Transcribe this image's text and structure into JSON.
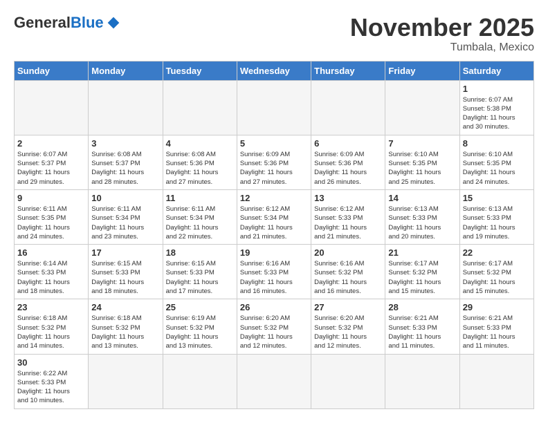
{
  "header": {
    "logo_general": "General",
    "logo_blue": "Blue",
    "month_title": "November 2025",
    "location": "Tumbala, Mexico"
  },
  "days_of_week": [
    "Sunday",
    "Monday",
    "Tuesday",
    "Wednesday",
    "Thursday",
    "Friday",
    "Saturday"
  ],
  "weeks": [
    [
      {
        "day": "",
        "info": ""
      },
      {
        "day": "",
        "info": ""
      },
      {
        "day": "",
        "info": ""
      },
      {
        "day": "",
        "info": ""
      },
      {
        "day": "",
        "info": ""
      },
      {
        "day": "",
        "info": ""
      },
      {
        "day": "1",
        "info": "Sunrise: 6:07 AM\nSunset: 5:38 PM\nDaylight: 11 hours\nand 30 minutes."
      }
    ],
    [
      {
        "day": "2",
        "info": "Sunrise: 6:07 AM\nSunset: 5:37 PM\nDaylight: 11 hours\nand 29 minutes."
      },
      {
        "day": "3",
        "info": "Sunrise: 6:08 AM\nSunset: 5:37 PM\nDaylight: 11 hours\nand 28 minutes."
      },
      {
        "day": "4",
        "info": "Sunrise: 6:08 AM\nSunset: 5:36 PM\nDaylight: 11 hours\nand 27 minutes."
      },
      {
        "day": "5",
        "info": "Sunrise: 6:09 AM\nSunset: 5:36 PM\nDaylight: 11 hours\nand 27 minutes."
      },
      {
        "day": "6",
        "info": "Sunrise: 6:09 AM\nSunset: 5:36 PM\nDaylight: 11 hours\nand 26 minutes."
      },
      {
        "day": "7",
        "info": "Sunrise: 6:10 AM\nSunset: 5:35 PM\nDaylight: 11 hours\nand 25 minutes."
      },
      {
        "day": "8",
        "info": "Sunrise: 6:10 AM\nSunset: 5:35 PM\nDaylight: 11 hours\nand 24 minutes."
      }
    ],
    [
      {
        "day": "9",
        "info": "Sunrise: 6:11 AM\nSunset: 5:35 PM\nDaylight: 11 hours\nand 24 minutes."
      },
      {
        "day": "10",
        "info": "Sunrise: 6:11 AM\nSunset: 5:34 PM\nDaylight: 11 hours\nand 23 minutes."
      },
      {
        "day": "11",
        "info": "Sunrise: 6:11 AM\nSunset: 5:34 PM\nDaylight: 11 hours\nand 22 minutes."
      },
      {
        "day": "12",
        "info": "Sunrise: 6:12 AM\nSunset: 5:34 PM\nDaylight: 11 hours\nand 21 minutes."
      },
      {
        "day": "13",
        "info": "Sunrise: 6:12 AM\nSunset: 5:33 PM\nDaylight: 11 hours\nand 21 minutes."
      },
      {
        "day": "14",
        "info": "Sunrise: 6:13 AM\nSunset: 5:33 PM\nDaylight: 11 hours\nand 20 minutes."
      },
      {
        "day": "15",
        "info": "Sunrise: 6:13 AM\nSunset: 5:33 PM\nDaylight: 11 hours\nand 19 minutes."
      }
    ],
    [
      {
        "day": "16",
        "info": "Sunrise: 6:14 AM\nSunset: 5:33 PM\nDaylight: 11 hours\nand 18 minutes."
      },
      {
        "day": "17",
        "info": "Sunrise: 6:15 AM\nSunset: 5:33 PM\nDaylight: 11 hours\nand 18 minutes."
      },
      {
        "day": "18",
        "info": "Sunrise: 6:15 AM\nSunset: 5:33 PM\nDaylight: 11 hours\nand 17 minutes."
      },
      {
        "day": "19",
        "info": "Sunrise: 6:16 AM\nSunset: 5:33 PM\nDaylight: 11 hours\nand 16 minutes."
      },
      {
        "day": "20",
        "info": "Sunrise: 6:16 AM\nSunset: 5:32 PM\nDaylight: 11 hours\nand 16 minutes."
      },
      {
        "day": "21",
        "info": "Sunrise: 6:17 AM\nSunset: 5:32 PM\nDaylight: 11 hours\nand 15 minutes."
      },
      {
        "day": "22",
        "info": "Sunrise: 6:17 AM\nSunset: 5:32 PM\nDaylight: 11 hours\nand 15 minutes."
      }
    ],
    [
      {
        "day": "23",
        "info": "Sunrise: 6:18 AM\nSunset: 5:32 PM\nDaylight: 11 hours\nand 14 minutes."
      },
      {
        "day": "24",
        "info": "Sunrise: 6:18 AM\nSunset: 5:32 PM\nDaylight: 11 hours\nand 13 minutes."
      },
      {
        "day": "25",
        "info": "Sunrise: 6:19 AM\nSunset: 5:32 PM\nDaylight: 11 hours\nand 13 minutes."
      },
      {
        "day": "26",
        "info": "Sunrise: 6:20 AM\nSunset: 5:32 PM\nDaylight: 11 hours\nand 12 minutes."
      },
      {
        "day": "27",
        "info": "Sunrise: 6:20 AM\nSunset: 5:32 PM\nDaylight: 11 hours\nand 12 minutes."
      },
      {
        "day": "28",
        "info": "Sunrise: 6:21 AM\nSunset: 5:33 PM\nDaylight: 11 hours\nand 11 minutes."
      },
      {
        "day": "29",
        "info": "Sunrise: 6:21 AM\nSunset: 5:33 PM\nDaylight: 11 hours\nand 11 minutes."
      }
    ],
    [
      {
        "day": "30",
        "info": "Sunrise: 6:22 AM\nSunset: 5:33 PM\nDaylight: 11 hours\nand 10 minutes."
      },
      {
        "day": "",
        "info": ""
      },
      {
        "day": "",
        "info": ""
      },
      {
        "day": "",
        "info": ""
      },
      {
        "day": "",
        "info": ""
      },
      {
        "day": "",
        "info": ""
      },
      {
        "day": "",
        "info": ""
      }
    ]
  ]
}
